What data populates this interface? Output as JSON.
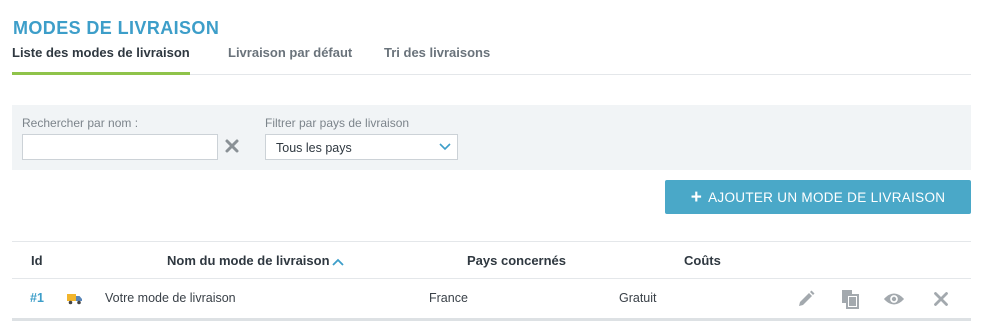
{
  "page": {
    "title": "MODES DE LIVRAISON"
  },
  "tabs": [
    {
      "label": "Liste des modes de livraison",
      "active": true
    },
    {
      "label": "Livraison par défaut",
      "active": false
    },
    {
      "label": "Tri des livraisons",
      "active": false
    }
  ],
  "filters": {
    "search_label": "Rechercher par nom :",
    "search_value": "",
    "clear_icon": "close-icon",
    "country_label": "Filtrer par pays de livraison",
    "country_selected": "Tous les pays"
  },
  "actions": {
    "add_label": "AJOUTER UN MODE DE LIVRAISON",
    "add_icon": "plus-icon"
  },
  "table": {
    "columns": {
      "id": "Id",
      "name": "Nom du mode de livraison",
      "countries": "Pays concernés",
      "costs": "Coûts"
    },
    "sort": {
      "column": "name",
      "direction": "ascending"
    },
    "rows": [
      {
        "id": "#1",
        "icon": "truck-icon",
        "name": "Votre mode de livraison",
        "countries": "France",
        "cost": "Gratuit",
        "row_actions": [
          "edit-icon",
          "duplicate-icon",
          "view-icon",
          "delete-icon"
        ]
      }
    ]
  },
  "colors": {
    "accent": "#3d9ec9",
    "tab_underline": "#8fc34a",
    "button": "#4aa8c8",
    "panel": "#f1f4f6",
    "icon_gray": "#a3a9ae"
  }
}
